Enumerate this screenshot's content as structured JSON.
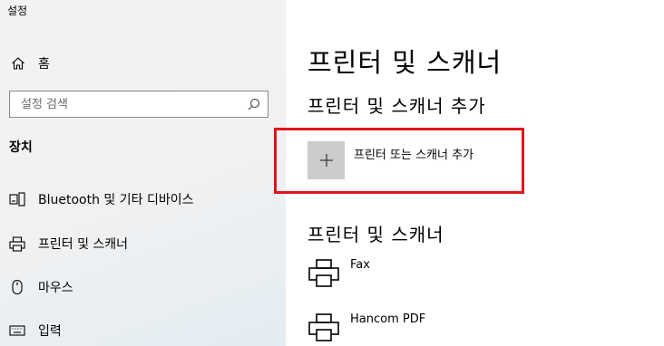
{
  "window": {
    "title": "설정"
  },
  "sidebar": {
    "home_label": "홈",
    "search_placeholder": "설정 검색",
    "section_title": "장치",
    "items": [
      {
        "label": "Bluetooth 및 기타 디바이스",
        "icon": "bluetooth-devices-icon"
      },
      {
        "label": "프린터 및 스캐너",
        "icon": "printer-icon"
      },
      {
        "label": "마우스",
        "icon": "mouse-icon"
      },
      {
        "label": "입력",
        "icon": "keyboard-icon"
      }
    ]
  },
  "main": {
    "page_title": "프린터 및 스캐너",
    "add_section_title": "프린터 및 스캐너 추가",
    "add_button_label": "프린터 또는 스캐너 추가",
    "list_section_title": "프린터 및 스캐너",
    "printers": [
      {
        "name": "Fax"
      },
      {
        "name": "Hancom PDF"
      }
    ]
  },
  "colors": {
    "highlight_border": "#e0141b",
    "add_tile": "#cccccc",
    "sidebar_bg": "#f2f2f2"
  }
}
